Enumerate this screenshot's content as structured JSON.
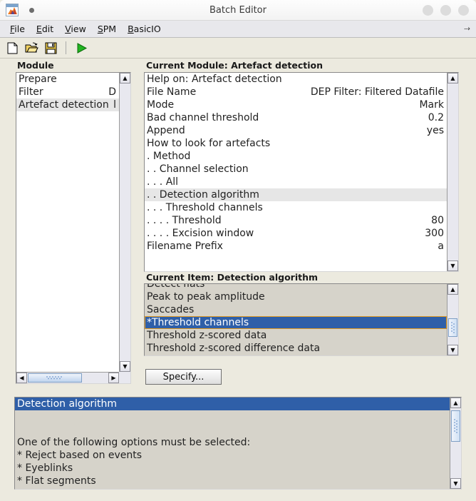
{
  "window": {
    "title": "Batch Editor",
    "app_icon": "matlab-icon",
    "modified_dot": "unsaved-indicator",
    "buttons": [
      "minimize",
      "maximize",
      "close"
    ]
  },
  "menubar": {
    "items": [
      {
        "label": "File",
        "accel": "F"
      },
      {
        "label": "Edit",
        "accel": "E"
      },
      {
        "label": "View",
        "accel": "V"
      },
      {
        "label": "SPM",
        "accel": "S"
      },
      {
        "label": "BasicIO",
        "accel": "B"
      }
    ],
    "overflow_icon": "menu-overflow-arrow"
  },
  "toolbar": {
    "buttons": [
      {
        "name": "new-file-icon",
        "tooltip": "New"
      },
      {
        "name": "open-file-icon",
        "tooltip": "Open"
      },
      {
        "name": "save-file-icon",
        "tooltip": "Save"
      },
      {
        "name": "run-icon",
        "tooltip": "Run"
      }
    ]
  },
  "module_panel": {
    "header": "Module",
    "items": [
      {
        "label": "Prepare",
        "value": "",
        "selected": false
      },
      {
        "label": "Filter",
        "value": "D",
        "selected": false
      },
      {
        "label": "Artefact detection",
        "value": "l",
        "selected": true
      }
    ]
  },
  "current_module": {
    "header": "Current Module: Artefact detection",
    "rows": [
      {
        "label": "Help on: Artefact detection",
        "value": "",
        "selected": false
      },
      {
        "label": "File Name",
        "value": "DEP Filter: Filtered Datafile",
        "selected": false
      },
      {
        "label": "Mode",
        "value": "Mark",
        "selected": false
      },
      {
        "label": "Bad channel threshold",
        "value": "0.2",
        "selected": false
      },
      {
        "label": "Append",
        "value": "yes",
        "selected": false
      },
      {
        "label": "How to look for artefacts",
        "value": "",
        "selected": false
      },
      {
        "label": " . Method",
        "value": "",
        "selected": false
      },
      {
        "label": " . . Channel selection",
        "value": "",
        "selected": false
      },
      {
        "label": " . . . All",
        "value": "",
        "selected": false
      },
      {
        "label": " . . Detection algorithm",
        "value": "",
        "selected": true
      },
      {
        "label": " . . . Threshold channels",
        "value": "",
        "selected": false
      },
      {
        "label": " . . . . Threshold",
        "value": "80",
        "selected": false
      },
      {
        "label": " . . . . Excision window",
        "value": "300",
        "selected": false
      },
      {
        "label": "Filename Prefix",
        "value": "a",
        "selected": false
      }
    ]
  },
  "current_item": {
    "header": "Current Item: Detection algorithm",
    "options": [
      {
        "label": "Detect flats",
        "selected": false,
        "clipped": true
      },
      {
        "label": "Peak to peak amplitude",
        "selected": false
      },
      {
        "label": "Saccades",
        "selected": false
      },
      {
        "label": "*Threshold channels",
        "selected": true
      },
      {
        "label": "Threshold z-scored data",
        "selected": false
      },
      {
        "label": "Threshold z-scored difference data",
        "selected": false
      }
    ],
    "specify_button": "Specify..."
  },
  "help_panel": {
    "title": "Detection algorithm",
    "lines": [
      "",
      "",
      "One of the following options must be selected:",
      "* Reject based on events",
      "* Eyeblinks",
      "* Flat segments"
    ]
  },
  "colors": {
    "window_bg": "#eceadf",
    "listbox_bg": "#d6d3ca",
    "selection_blue": "#2f5fa8",
    "focus_orange": "#e09a23",
    "soft_select": "#e6e6e6",
    "text": "#222222",
    "run_green": "#22b421"
  }
}
